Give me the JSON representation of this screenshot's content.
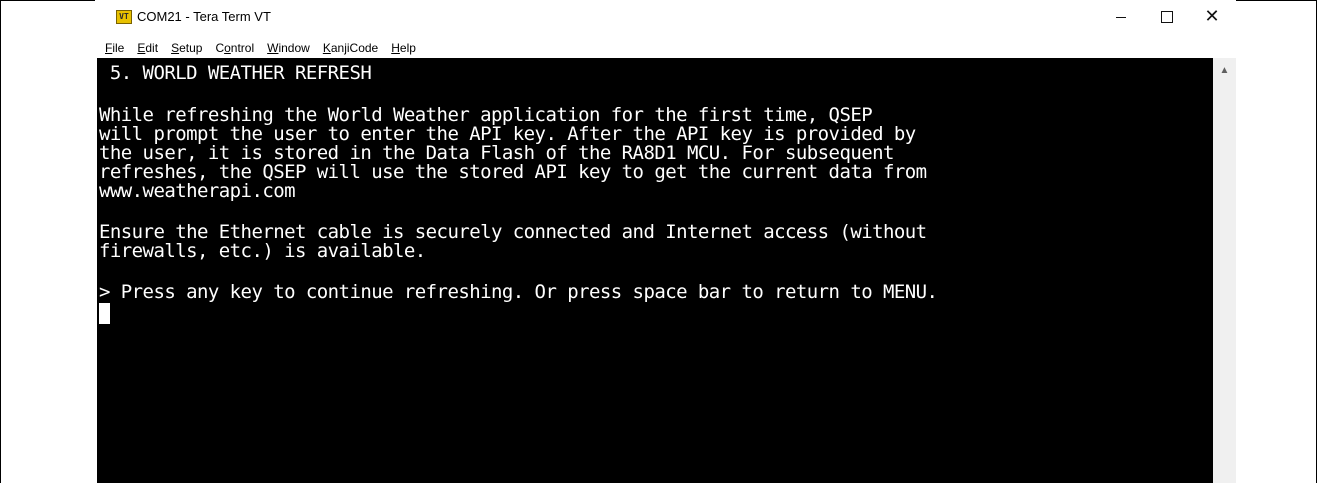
{
  "window": {
    "title": "COM21 - Tera Term VT",
    "app_icon_text": "VT",
    "controls": {
      "minimize": "minimize",
      "maximize": "maximize",
      "close": "close"
    }
  },
  "menu": {
    "items": [
      {
        "hot": "F",
        "rest": "ile"
      },
      {
        "hot": "E",
        "rest": "dit"
      },
      {
        "hot": "S",
        "rest": "etup"
      },
      {
        "pre": "C",
        "hot": "o",
        "rest": "ntrol"
      },
      {
        "hot": "W",
        "rest": "indow"
      },
      {
        "hot": "K",
        "rest": "anjiCode"
      },
      {
        "hot": "H",
        "rest": "elp"
      }
    ]
  },
  "terminal": {
    "lines": [
      " 5. WORLD WEATHER REFRESH",
      "",
      "While refreshing the World Weather application for the first time, QSEP",
      "will prompt the user to enter the API key. After the API key is provided by",
      "the user, it is stored in the Data Flash of the RA8D1 MCU. For subsequent",
      "refreshes, the QSEP will use the stored API key to get the current data from",
      "www.weatherapi.com",
      "",
      "Ensure the Ethernet cable is securely connected and Internet access (without",
      "firewalls, etc.) is available.",
      "",
      "> Press any key to continue refreshing. Or press space bar to return to MENU."
    ]
  },
  "colors": {
    "terminal_bg": "#000000",
    "terminal_fg": "#ffffff",
    "icon_yellow": "#e8c100"
  }
}
